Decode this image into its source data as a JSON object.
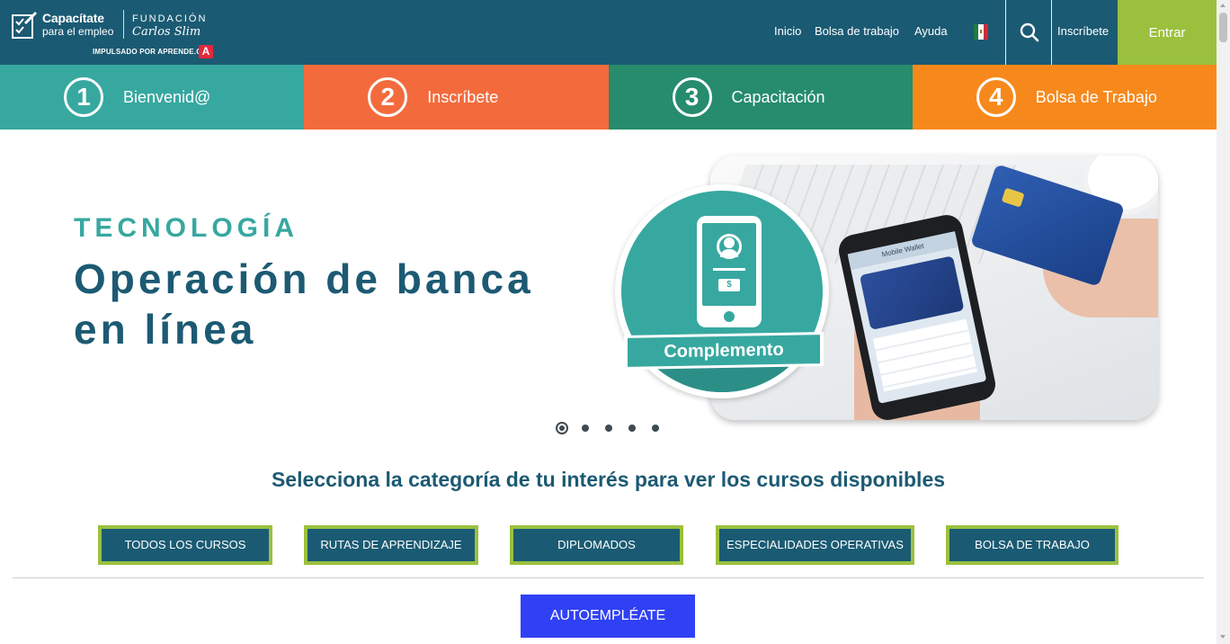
{
  "header": {
    "logo": {
      "brand_line1": "Capacítate",
      "brand_line2": "para el empleo",
      "foundation_line1": "FUNDACIÓN",
      "foundation_line2": "Carlos Slim",
      "powered_by": "IMPULSADO POR APRENDE.ORG",
      "badge": "A"
    },
    "nav": [
      "Inicio",
      "Bolsa de trabajo",
      "Ayuda"
    ],
    "country_flag": "flag-mexico-icon",
    "search_icon": "search-icon",
    "signup_label": "Inscríbete",
    "enter_label": "Entrar"
  },
  "steps": [
    {
      "number": "1",
      "label": "Bienvenid@",
      "color": "#37a8a0"
    },
    {
      "number": "2",
      "label": "Inscríbete",
      "color": "#f36b3d"
    },
    {
      "number": "3",
      "label": "Capacitación",
      "color": "#268c6c"
    },
    {
      "number": "4",
      "label": "Bolsa de Trabajo",
      "color": "#f7891c"
    }
  ],
  "banner": {
    "category": "TECNOLOGÍA",
    "title": "Operación de banca en línea",
    "badge_label": "Complemento",
    "badge_dollar": "$",
    "phone_screen_title": "Mobile Wallet",
    "slide_count": 5,
    "active_slide": 1
  },
  "categories": {
    "heading": "Selecciona la categoría de tu interés para ver los cursos disponibles",
    "buttons": [
      "TODOS LOS CURSOS",
      "RUTAS DE APRENDIZAJE",
      "DIPLOMADOS",
      "ESPECIALIDADES OPERATIVAS",
      "BOLSA DE TRABAJO"
    ]
  },
  "cta": {
    "label": "AUTOEMPLÉATE"
  },
  "colors": {
    "header_bg": "#1b5a73",
    "accent_green": "#9bc03e",
    "teal": "#37a8a0",
    "cta_blue": "#3041f5"
  }
}
